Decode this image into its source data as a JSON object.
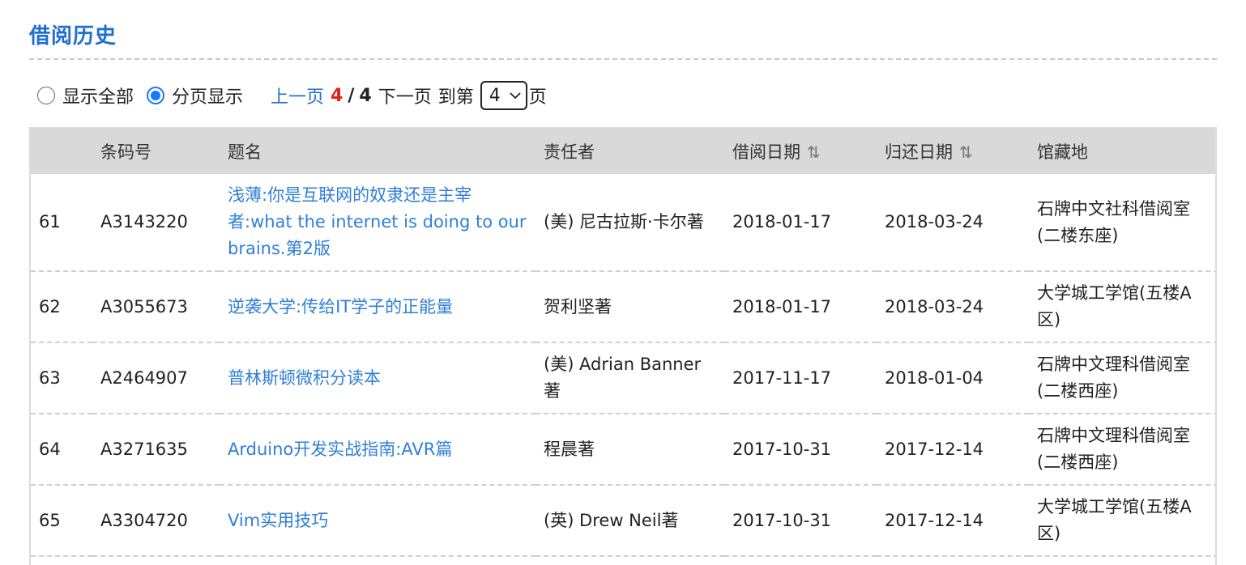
{
  "header": {
    "title": "借阅历史"
  },
  "display_options": {
    "show_all_label": "显示全部",
    "paged_label": "分页显示",
    "selected": "paged"
  },
  "pager": {
    "prev_label": "上一页",
    "current_page": "4",
    "separator": "/",
    "total_pages": "4",
    "next_label": "下一页",
    "goto_prefix": "到第",
    "selected_page": "4",
    "goto_suffix": "页"
  },
  "table": {
    "columns": {
      "no": "",
      "barcode": "条码号",
      "title": "题名",
      "author": "责任者",
      "borrow_date": "借阅日期",
      "return_date": "归还日期",
      "location": "馆藏地"
    },
    "rows": [
      {
        "no": "61",
        "barcode": "A3143220",
        "title": "浅薄:你是互联网的奴隶还是主宰者:what the internet is doing to our brains.第2版",
        "author": "(美) 尼古拉斯·卡尔著",
        "borrow_date": "2018-01-17",
        "return_date": "2018-03-24",
        "location": "石牌中文社科借阅室(二楼东座)"
      },
      {
        "no": "62",
        "barcode": "A3055673",
        "title": "逆袭大学:传给IT学子的正能量",
        "author": "贺利坚著",
        "borrow_date": "2018-01-17",
        "return_date": "2018-03-24",
        "location": "大学城工学馆(五楼A区)"
      },
      {
        "no": "63",
        "barcode": "A2464907",
        "title": "普林斯顿微积分读本",
        "author": "(美) Adrian Banner著",
        "borrow_date": "2017-11-17",
        "return_date": "2018-01-04",
        "location": "石牌中文理科借阅室(二楼西座)"
      },
      {
        "no": "64",
        "barcode": "A3271635",
        "title": "Arduino开发实战指南:AVR篇",
        "author": "程晨著",
        "borrow_date": "2017-10-31",
        "return_date": "2017-12-14",
        "location": "石牌中文理科借阅室(二楼西座)"
      },
      {
        "no": "65",
        "barcode": "A3304720",
        "title": "Vim实用技巧",
        "author": "(英) Drew Neil著",
        "borrow_date": "2017-10-31",
        "return_date": "2017-12-14",
        "location": "大学城工学馆(五楼A区)"
      }
    ]
  },
  "colors": {
    "title_blue": "#1f6fd1",
    "link_blue": "#2f7fd8",
    "current_page_red": "#e0221b",
    "radio_blue": "#1677ff",
    "header_bg": "#d9d9d9"
  },
  "icons": {
    "sort": "sort-updown-icon",
    "select": "chevron-down-icon"
  }
}
